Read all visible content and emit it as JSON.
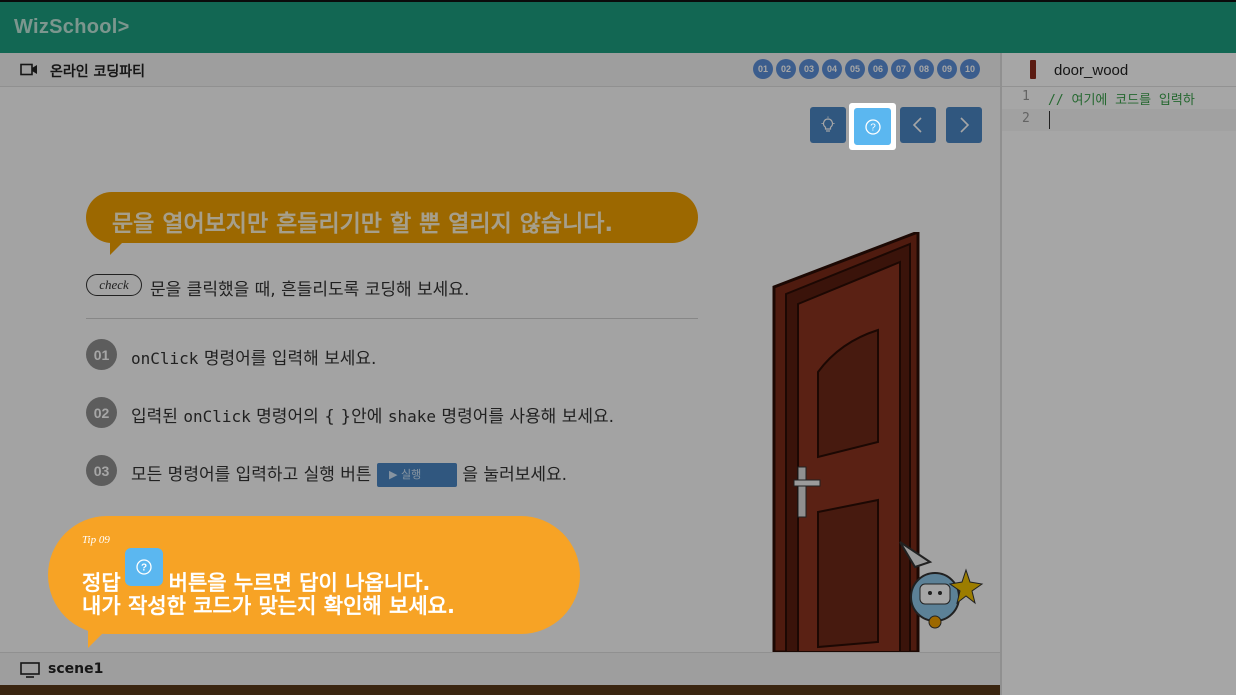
{
  "app": {
    "logo": "WizSchool>"
  },
  "lesson": {
    "header_title": "온라인 코딩파티",
    "steps": [
      "01",
      "02",
      "03",
      "04",
      "05",
      "06",
      "07",
      "08",
      "09",
      "10"
    ],
    "title": "문을 열어보지만 흔들리기만 할 뿐 열리지 않습니다.",
    "check_badge": "check",
    "check_text": "문을 클릭했을 때, 흔들리도록 코딩해 보세요.",
    "items": [
      {
        "num": "01",
        "parts": [
          "onClick",
          " 명령어를 입력해 보세요."
        ]
      },
      {
        "num": "02",
        "parts": [
          "입력된 ",
          "onClick",
          " 명령어의 {  }안에 ",
          "shake",
          " 명령어를 사용해 보세요."
        ]
      },
      {
        "num": "03",
        "parts": [
          "모든 명령어를 입력하고 실행 버튼 ",
          "실행",
          " 을 눌러보세요."
        ]
      }
    ]
  },
  "scene": {
    "label": "scene1"
  },
  "editor": {
    "file_name": "door_wood",
    "lines": [
      {
        "num": "1",
        "text": "// 여기에 코드를 입력하"
      },
      {
        "num": "2",
        "text": ""
      }
    ]
  },
  "tip": {
    "label": "Tip 09",
    "line1_a": "정답",
    "line1_b": "버튼을 누르면 답이 나옵니다.",
    "line2": "내가 작성한 코드가 맞는지 확인해 보세요."
  },
  "colors": {
    "topbar": "#1c9e80",
    "accent_orange": "#f7a325",
    "button_blue": "#4a86c4",
    "answer_blue": "#5bb7f0"
  }
}
